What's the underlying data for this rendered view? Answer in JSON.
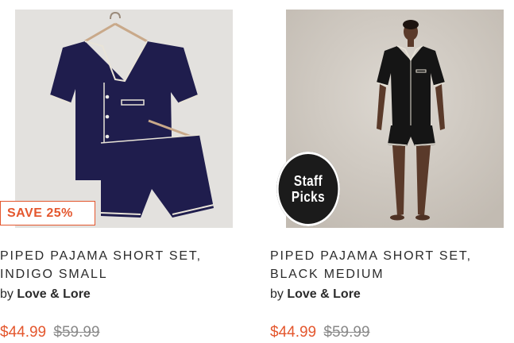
{
  "products": [
    {
      "title_line1": "PIPED PAJAMA SHORT SET,",
      "title_line2": "INDIGO SMALL",
      "by_label": "by",
      "brand": "Love & Lore",
      "sale_price": "$44.99",
      "original_price": "$59.99",
      "badge": "SAVE 25%",
      "garment_color": "#1f1d4d"
    },
    {
      "title_line1": "PIPED PAJAMA SHORT SET,",
      "title_line2": "BLACK MEDIUM",
      "by_label": "by",
      "brand": "Love & Lore",
      "sale_price": "$44.99",
      "original_price": "$59.99",
      "badge_line1": "Staff",
      "badge_line2": "Picks",
      "garment_color": "#151515"
    }
  ],
  "colors": {
    "accent": "#e4572e",
    "text": "#2b2b2b",
    "muted": "#8a8a8a"
  }
}
